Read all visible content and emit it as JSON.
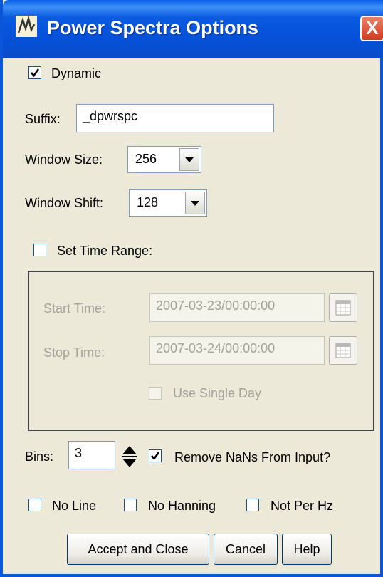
{
  "window": {
    "title": "Power Spectra Options",
    "close_label": "X"
  },
  "dynamic": {
    "label": "Dynamic",
    "checked": true
  },
  "suffix": {
    "label": "Suffix:",
    "value": "_dpwrspc"
  },
  "window_size": {
    "label": "Window Size:",
    "value": "256"
  },
  "window_shift": {
    "label": "Window Shift:",
    "value": "128"
  },
  "time_range": {
    "label": "Set Time Range:",
    "checked": false,
    "start_label": "Start Time:",
    "start_value": "2007-03-23/00:00:00",
    "stop_label": "Stop Time:",
    "stop_value": "2007-03-24/00:00:00",
    "single_day_label": "Use Single Day"
  },
  "bins": {
    "label": "Bins:",
    "value": "3"
  },
  "remove_nans": {
    "label": "Remove NaNs From Input?",
    "checked": true
  },
  "options": {
    "no_line": "No Line",
    "no_hanning": "No Hanning",
    "not_per_hz": "Not Per Hz"
  },
  "buttons": {
    "accept": "Accept and Close",
    "cancel": "Cancel",
    "help": "Help"
  }
}
